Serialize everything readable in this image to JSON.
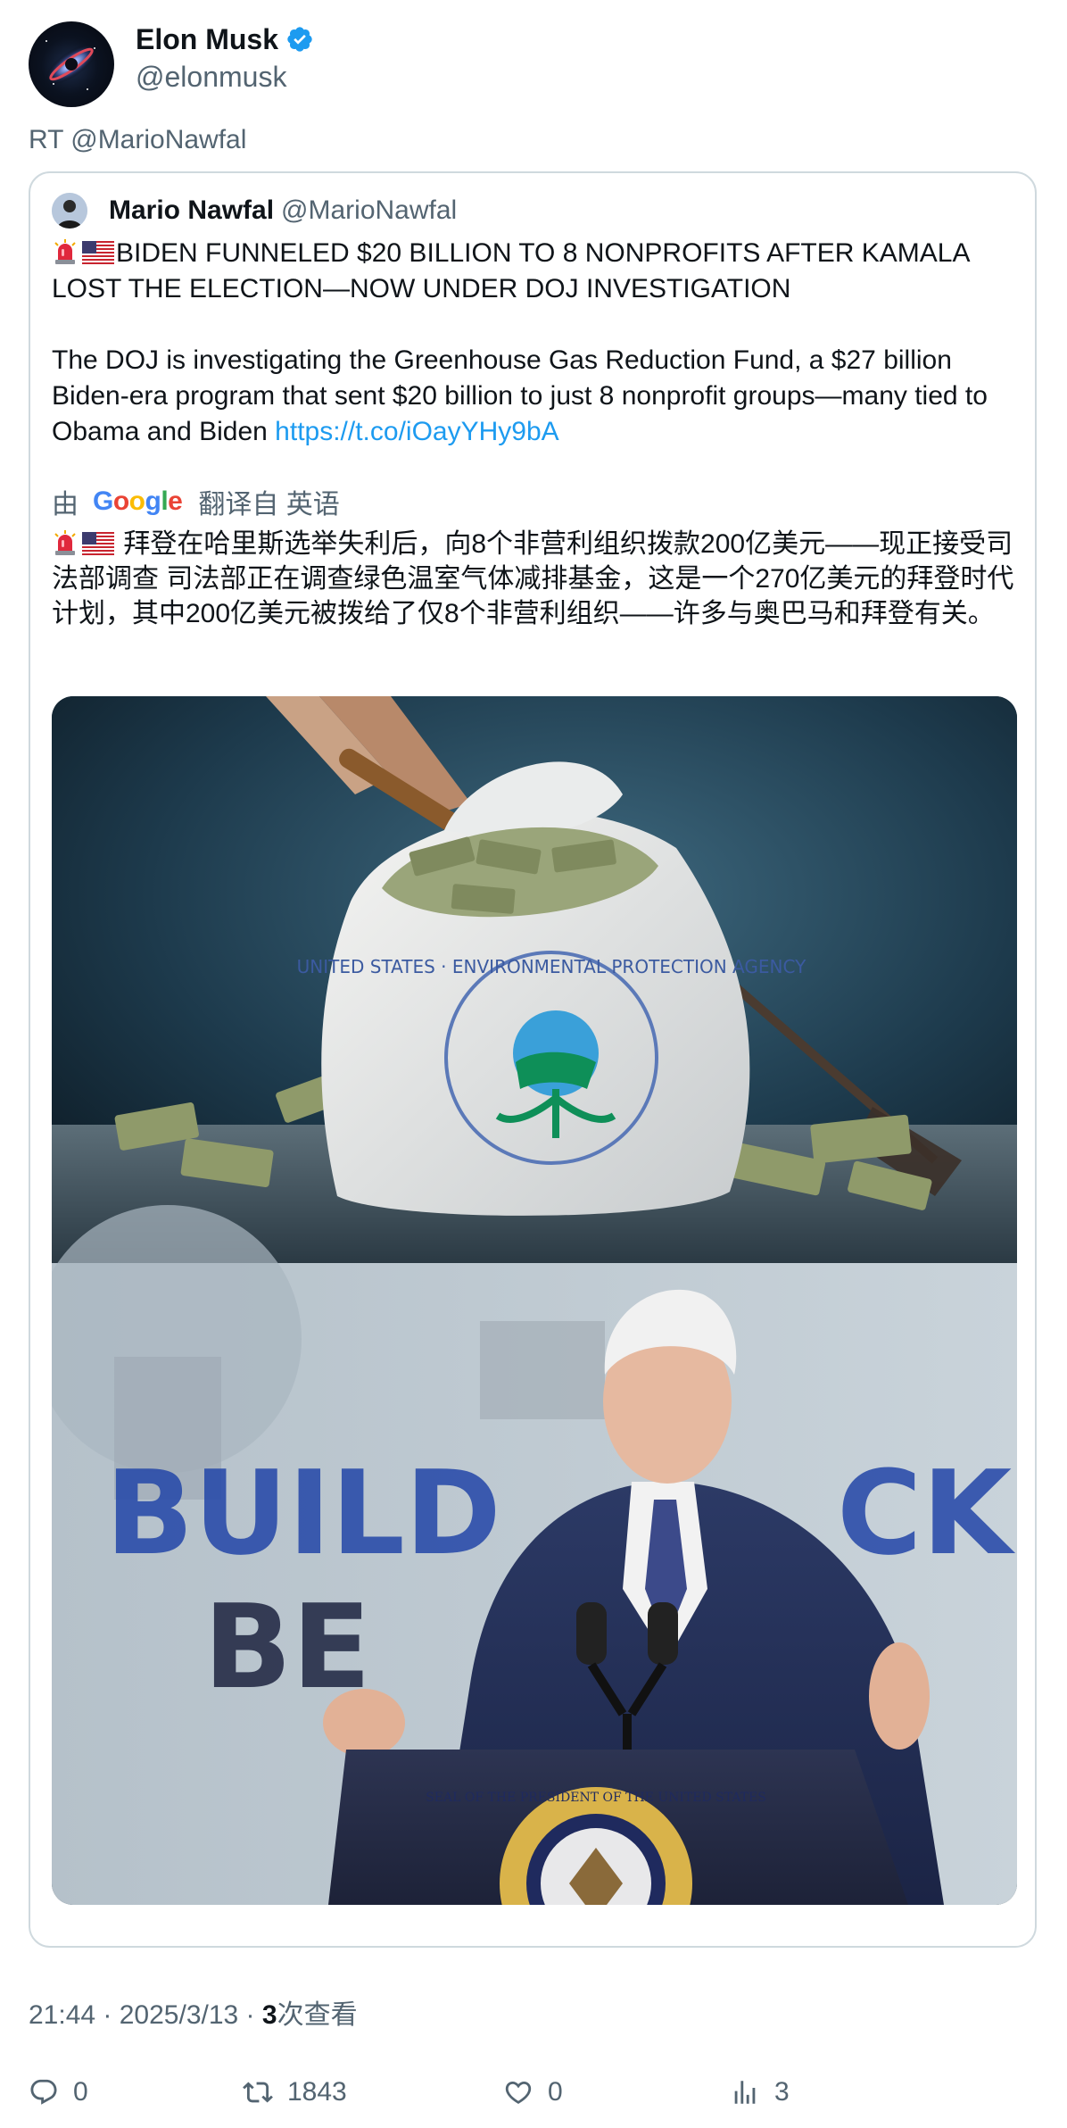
{
  "author": {
    "display_name": "Elon Musk",
    "handle": "@elonmusk",
    "verified": true,
    "avatar_icon": "galaxy-avatar"
  },
  "retweet_line": "RT @MarioNawfal",
  "quoted_tweet": {
    "display_name": "Mario Nawfal",
    "handle": "@MarioNawfal",
    "headline": "BIDEN FUNNELED $20 BILLION TO 8 NONPROFITS AFTER KAMALA LOST THE ELECTION—NOW UNDER DOJ INVESTIGATION",
    "body": "The DOJ is investigating the Greenhouse Gas Reduction Fund, a $27 billion Biden-era program that sent $20 billion to just 8 nonprofit groups—many tied to Obama and Biden ",
    "link": "https://t.co/iOayYHy9bA",
    "translation_prefix": "由",
    "translation_provider": "Google",
    "translation_suffix": "翻译自 英语",
    "translated_text": "拜登在哈里斯选举失利后，向8个非营利组织拨款200亿美元——现正接受司法部调查 司法部正在调查绿色温室气体减排基金，这是一个270亿美元的拜登时代计划，其中200亿美元被拨给了仅8个非营利组织——许多与奥巴马和拜登有关。",
    "emojis": [
      "siren-emoji",
      "us-flag-emoji"
    ],
    "media": {
      "top_image_text": "UNITED STATES · ENVIRONMENTAL PROTECTION AGENCY",
      "bottom_image_text_line1": "BUILD",
      "bottom_image_text_line1b": "CK",
      "bottom_image_text_line2": "BE",
      "seal_text": "SEAL OF THE PRESIDENT OF THE UNITED STATES"
    }
  },
  "meta": {
    "time": "21:44",
    "date": "2025/3/13",
    "separator": " · ",
    "views_count": "3",
    "views_label": "次查看"
  },
  "actions": {
    "replies": "0",
    "retweets": "1843",
    "likes": "0",
    "views": "3"
  },
  "colors": {
    "link": "#1d9bf0",
    "secondary_text": "#536471",
    "border": "#cfd9de",
    "verified": "#1d9bf0"
  }
}
